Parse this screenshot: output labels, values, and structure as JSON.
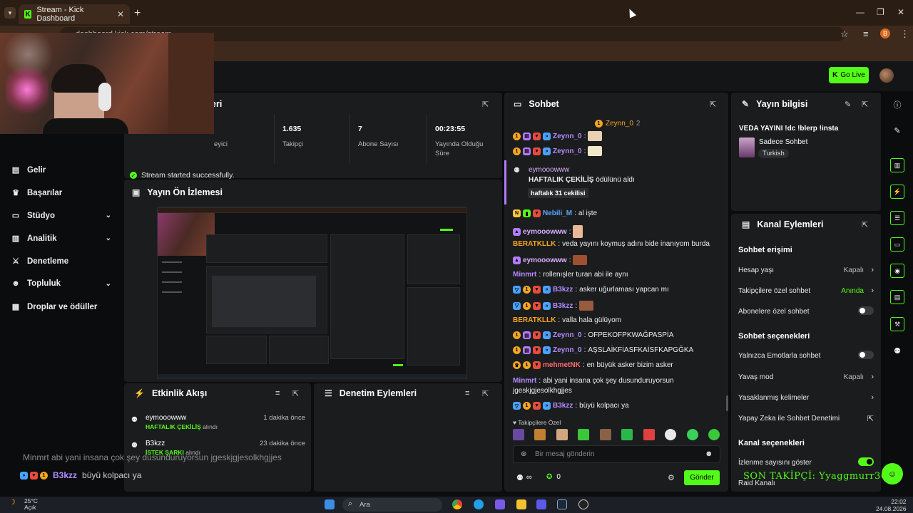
{
  "browser": {
    "tab_title": "Stream - Kick Dashboard",
    "url": "dashboard.kick.com/stream"
  },
  "header": {
    "go_live": "Go Live"
  },
  "nav": {
    "items": [
      {
        "label": "Gelir",
        "icon": "wallet-icon"
      },
      {
        "label": "Başarılar",
        "icon": "trophy-icon"
      },
      {
        "label": "Stüdyo",
        "icon": "studio-icon"
      },
      {
        "label": "Analitik",
        "icon": "chart-icon"
      },
      {
        "label": "Denetleme",
        "icon": "sword-icon"
      },
      {
        "label": "Topluluk",
        "icon": "people-icon"
      },
      {
        "label": "Droplar ve ödüller",
        "icon": "gift-icon"
      }
    ]
  },
  "stats": {
    "title_partial": "eri",
    "viewer_label_partial": "eyici",
    "followers_value": "1.635",
    "followers_label": "Takipçi",
    "subs_value": "7",
    "subs_label": "Abone Sayısı",
    "uptime_value": "00:23:55",
    "uptime_label_1": "Yayında Olduğu",
    "uptime_label_2": "Süre",
    "success": "Stream started successfully."
  },
  "preview": {
    "title": "Yayın Ön İzlemesi"
  },
  "activity": {
    "title": "Etkinlik Akışı",
    "items": [
      {
        "user": "eymooowww",
        "event": "HAFTALIK ÇEKİLİŞ",
        "suffix": "alındı",
        "time": "1 dakika önce"
      },
      {
        "user": "B3kzz",
        "event": "İSTEK ŞARKI",
        "suffix": "alındı",
        "time": "23 dakika önce"
      }
    ]
  },
  "moderation": {
    "title": "Denetim Eylemleri"
  },
  "overlay_chat": {
    "line1": "Minmrt abi yani insana çok şey dusunduruyorsun jgeskjgjesolkhgjjes",
    "line2_user": "B3kzz",
    "line2_text": "büyü kolpacı ya"
  },
  "chat": {
    "title": "Sohbet",
    "pinned_user": "Zeynn_0",
    "pinned_count": "2",
    "reward_user": "eymooowww",
    "reward_event": "HAFTALIK ÇEKİLİŞ",
    "reward_suffix": "ödülünü aldı",
    "reward_note": "haftalık 31 cekilisi",
    "messages": [
      {
        "user": "Zeynn_0",
        "text": "",
        "color": "purple"
      },
      {
        "user": "Zeynn_0",
        "text": "",
        "color": "purple"
      },
      {
        "user": "Nebili_M",
        "text": "al işte",
        "color": "blue"
      },
      {
        "user": "eymooowww",
        "text": "",
        "color": "pink"
      },
      {
        "user": "BERATKLLK",
        "text": "veda yayını koymuş adını bide inanıyom burda",
        "color": "orange"
      },
      {
        "user": "eymooowww",
        "text": "",
        "color": "pink"
      },
      {
        "user": "Minmrt",
        "text": "rollenışler turan abi ile aynı",
        "color": "purple"
      },
      {
        "user": "B3kzz",
        "text": "asker uğurlaması yapcan mı",
        "color": "purple"
      },
      {
        "user": "B3kzz",
        "text": "",
        "color": "purple"
      },
      {
        "user": "BERATKLLK",
        "text": "valla hala gülüyom",
        "color": "orange"
      },
      {
        "user": "Zeynn_0",
        "text": "OFPEKOFPKWAĞPASPİA",
        "color": "purple"
      },
      {
        "user": "Zeynn_0",
        "text": "AŞSLAİKFİASFKAİSFKAPGĞKA",
        "color": "purple"
      },
      {
        "user": "mehmetNK",
        "text": "en büyük asker bizim asker",
        "color": "red"
      },
      {
        "user": "Minmrt",
        "text": "abi yani insana çok şey dusunduruyorsun",
        "text2": "jgeskjgjesolkhgjjes",
        "color": "purple"
      },
      {
        "user": "B3kzz",
        "text": "büyü kolpacı ya",
        "color": "purple"
      }
    ],
    "followers_only": "Takipçilere Özel",
    "input_placeholder": "Bir mesaj gönderin",
    "points": "∞",
    "coins": "0",
    "send": "Gönder"
  },
  "stream_info": {
    "title": "Yayın bilgisi",
    "stream_title": "VEDA YAYINI !dc !blerp !insta",
    "category": "Sadece Sohbet",
    "tag": "Turkish"
  },
  "channel_actions": {
    "title": "Kanal Eylemleri",
    "chat_access": "Sohbet erişimi",
    "account_age": "Hesap yaşı",
    "account_age_val": "Kapalı",
    "followers_chat": "Takipçilere özel sohbet",
    "followers_chat_val": "Anında",
    "subs_chat": "Abonelere özel sohbet",
    "chat_options": "Sohbet seçenekleri",
    "emote_only": "Yalnızca Emotlarla sohbet",
    "slow_mode": "Yavaş mod",
    "slow_mode_val": "Kapalı",
    "banned_words": "Yasaklanmış kelimeler",
    "ai_mod": "Yapay Zeka ile Sohbet Denetimi",
    "channel_options": "Kanal seçenekleri",
    "show_viewers": "İzlenme sayısını göster",
    "raid": "Raid Kanalı"
  },
  "last_follower": "SON TAKİPÇİ: Yyaggmurr36",
  "taskbar": {
    "temp": "25°C",
    "weather": "Açık",
    "search": "Ara",
    "time": "22:02",
    "date": "24.08.2026"
  },
  "colors": {
    "accent": "#53fc18",
    "panel": "#1b1c1e",
    "bg": "#0b0c0d"
  }
}
